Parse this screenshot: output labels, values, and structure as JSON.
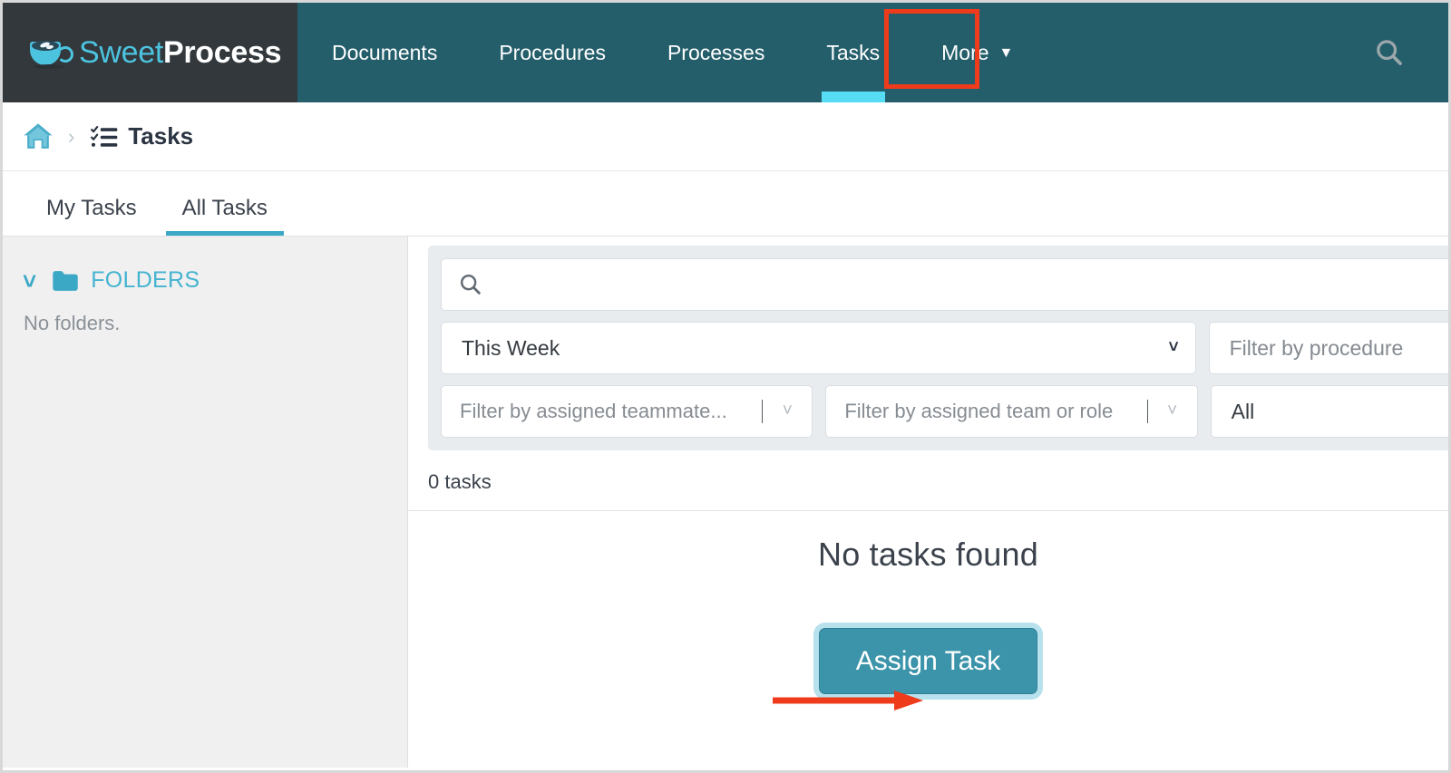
{
  "brand": {
    "name_light": "Sweet",
    "name_bold": "Process",
    "logo_icon": "coffee-cup-icon",
    "light_color": "#4cc4e0",
    "bar_color": "#245e6b",
    "logo_bg": "#32383c"
  },
  "topnav": {
    "items": [
      {
        "label": "Documents",
        "active": false,
        "has_caret": false
      },
      {
        "label": "Procedures",
        "active": false,
        "has_caret": false
      },
      {
        "label": "Processes",
        "active": false,
        "has_caret": false
      },
      {
        "label": "Tasks",
        "active": true,
        "has_caret": false
      },
      {
        "label": "More",
        "active": false,
        "has_caret": true
      }
    ],
    "search_icon": "search-icon",
    "active_indicator_color": "#57dcf5",
    "highlight_color": "#ee3b1b"
  },
  "breadcrumb": {
    "home_icon": "home-icon",
    "separator": "›",
    "current_icon": "tasks-checklist-icon",
    "current_label": "Tasks"
  },
  "tabs": [
    {
      "label": "My Tasks",
      "active": false
    },
    {
      "label": "All Tasks",
      "active": true
    }
  ],
  "sidebar": {
    "chevron_icon": "chevron-down-icon",
    "folder_icon": "folder-icon",
    "section_label": "FOLDERS",
    "empty_text": "No folders.",
    "accent_color": "#45b4d0"
  },
  "filters": {
    "search": {
      "icon": "search-icon",
      "value": "",
      "placeholder": ""
    },
    "date_range": {
      "value": "This Week",
      "chevron": "⌄"
    },
    "procedure": {
      "value": "Filter by procedure",
      "is_placeholder": true
    },
    "teammate": {
      "value": "Filter by assigned teammate...",
      "is_placeholder": true
    },
    "team_or_role": {
      "value": "Filter by assigned team or role",
      "is_placeholder": true
    },
    "status": {
      "value": "All"
    }
  },
  "results": {
    "count_label": "0 tasks",
    "empty_title": "No tasks found",
    "assign_button": "Assign Task",
    "assign_button_color": "#3c94aa",
    "assign_button_glow": "#b7e2ed"
  },
  "annotations": {
    "arrow_color": "#ee3b1b",
    "box_target": "Tasks"
  }
}
